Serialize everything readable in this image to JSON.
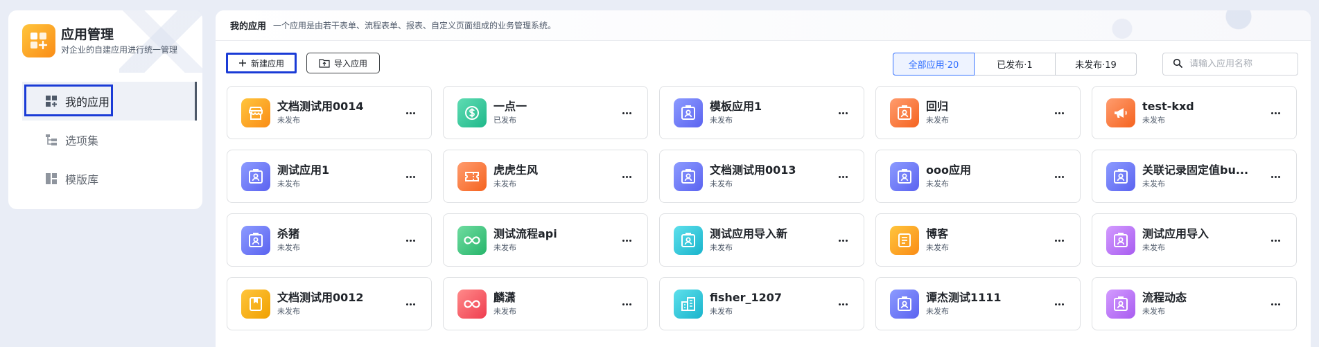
{
  "sidebar": {
    "title": "应用管理",
    "subtitle": "对企业的自建应用进行统一管理",
    "items": [
      {
        "label": "我的应用",
        "active": true,
        "icon": "grid-apps-icon"
      },
      {
        "label": "选项集",
        "active": false,
        "icon": "tree-list-icon"
      },
      {
        "label": "模版库",
        "active": false,
        "icon": "template-icon"
      }
    ]
  },
  "header": {
    "title": "我的应用",
    "description": "一个应用是由若干表单、流程表单、报表、自定义页面组成的业务管理系统。"
  },
  "toolbar": {
    "new_label": "新建应用",
    "import_label": "导入应用",
    "filters": [
      "全部应用·20",
      "已发布·1",
      "未发布·19"
    ],
    "active_filter": 0,
    "search_placeholder": "请输入应用名称"
  },
  "apps": [
    {
      "name": "文档测试用0014",
      "status": "未发布",
      "color": [
        "#ffc53d",
        "#fa8c16"
      ],
      "icon": "store-icon"
    },
    {
      "name": "一点一",
      "status": "已发布",
      "color": [
        "#5fdcb3",
        "#1fb88a"
      ],
      "icon": "dollar-icon"
    },
    {
      "name": "模板应用1",
      "status": "未发布",
      "color": [
        "#8c9bff",
        "#5b63f0"
      ],
      "icon": "badge-icon"
    },
    {
      "name": "回归",
      "status": "未发布",
      "color": [
        "#ff9c6e",
        "#f5631f"
      ],
      "icon": "badge-icon"
    },
    {
      "name": "test-kxd",
      "status": "未发布",
      "color": [
        "#ff9c6e",
        "#f5631f"
      ],
      "icon": "megaphone-icon"
    },
    {
      "name": "测试应用1",
      "status": "未发布",
      "color": [
        "#8c9bff",
        "#5b63f0"
      ],
      "icon": "badge-icon"
    },
    {
      "name": "虎虎生风",
      "status": "未发布",
      "color": [
        "#ff9c6e",
        "#f5631f"
      ],
      "icon": "ticket-icon"
    },
    {
      "name": "文档测试用0013",
      "status": "未发布",
      "color": [
        "#8c9bff",
        "#5b63f0"
      ],
      "icon": "badge-icon"
    },
    {
      "name": "ooo应用",
      "status": "未发布",
      "color": [
        "#8c9bff",
        "#5b63f0"
      ],
      "icon": "badge-icon"
    },
    {
      "name": "关联记录固定值bu...",
      "status": "未发布",
      "color": [
        "#8c9bff",
        "#5b63f0"
      ],
      "icon": "badge-icon"
    },
    {
      "name": "杀猪",
      "status": "未发布",
      "color": [
        "#8c9bff",
        "#5b63f0"
      ],
      "icon": "badge-icon"
    },
    {
      "name": "测试流程api",
      "status": "未发布",
      "color": [
        "#6fdca0",
        "#27b56b"
      ],
      "icon": "infinity-icon"
    },
    {
      "name": "测试应用导入新",
      "status": "未发布",
      "color": [
        "#5ee0ec",
        "#19b4cc"
      ],
      "icon": "badge-icon"
    },
    {
      "name": "博客",
      "status": "未发布",
      "color": [
        "#ffc53d",
        "#fa8c16"
      ],
      "icon": "document-icon"
    },
    {
      "name": "测试应用导入",
      "status": "未发布",
      "color": [
        "#d39bff",
        "#a85cf0"
      ],
      "icon": "badge-icon"
    },
    {
      "name": "文档测试用0012",
      "status": "未发布",
      "color": [
        "#ffc53d",
        "#f0a000"
      ],
      "icon": "bookmark-icon"
    },
    {
      "name": "麟潇",
      "status": "未发布",
      "color": [
        "#ff8a8a",
        "#ef3d4f"
      ],
      "icon": "infinity-icon"
    },
    {
      "name": "fisher_1207",
      "status": "未发布",
      "color": [
        "#5ee0ec",
        "#19b4cc"
      ],
      "icon": "building-icon"
    },
    {
      "name": "谭杰测试1111",
      "status": "未发布",
      "color": [
        "#8c9bff",
        "#5b63f0"
      ],
      "icon": "badge-icon"
    },
    {
      "name": "流程动态",
      "status": "未发布",
      "color": [
        "#d39bff",
        "#a85cf0"
      ],
      "icon": "badge-icon"
    }
  ]
}
